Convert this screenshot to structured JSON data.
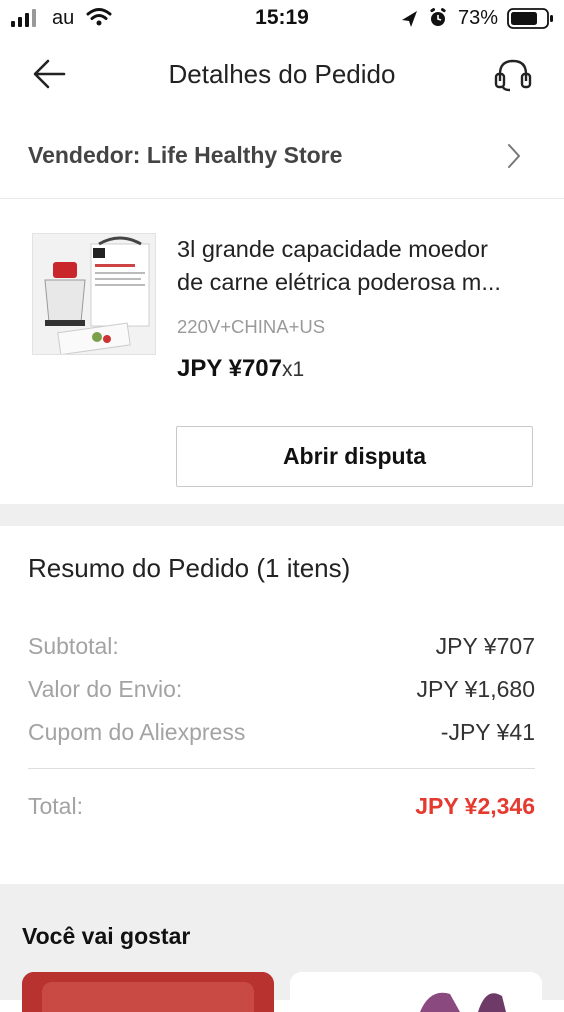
{
  "status_bar": {
    "carrier": "au",
    "time": "15:19",
    "battery": "73%"
  },
  "nav": {
    "title": "Detalhes do Pedido"
  },
  "seller": {
    "label": "Vendedor: Life Healthy Store"
  },
  "product": {
    "name_line1": "3l grande capacidade moedor",
    "name_line2": "de carne elétrica poderosa m...",
    "variant": "220V+CHINA+US",
    "price": "JPY ¥707",
    "quantity": "x1",
    "dispute_button": "Abrir disputa"
  },
  "summary": {
    "title": "Resumo do Pedido (1 itens)",
    "rows": [
      {
        "label": "Subtotal:",
        "value": "JPY ¥707"
      },
      {
        "label": "Valor do Envio:",
        "value": "JPY ¥1,680"
      },
      {
        "label": "Cupom do Aliexpress",
        "value": "-JPY ¥41"
      }
    ],
    "total_label": "Total:",
    "total_value": "JPY ¥2,346",
    "total_color": "#e53a2f"
  },
  "recommendations": {
    "title": "Você vai gostar"
  },
  "icons": {
    "back": "back-arrow-icon",
    "support": "headset-icon",
    "chevron": "chevron-right-icon",
    "location": "location-arrow-icon",
    "alarm": "alarm-icon",
    "wifi": "wifi-icon",
    "signal": "signal-icon",
    "battery": "battery-icon"
  }
}
